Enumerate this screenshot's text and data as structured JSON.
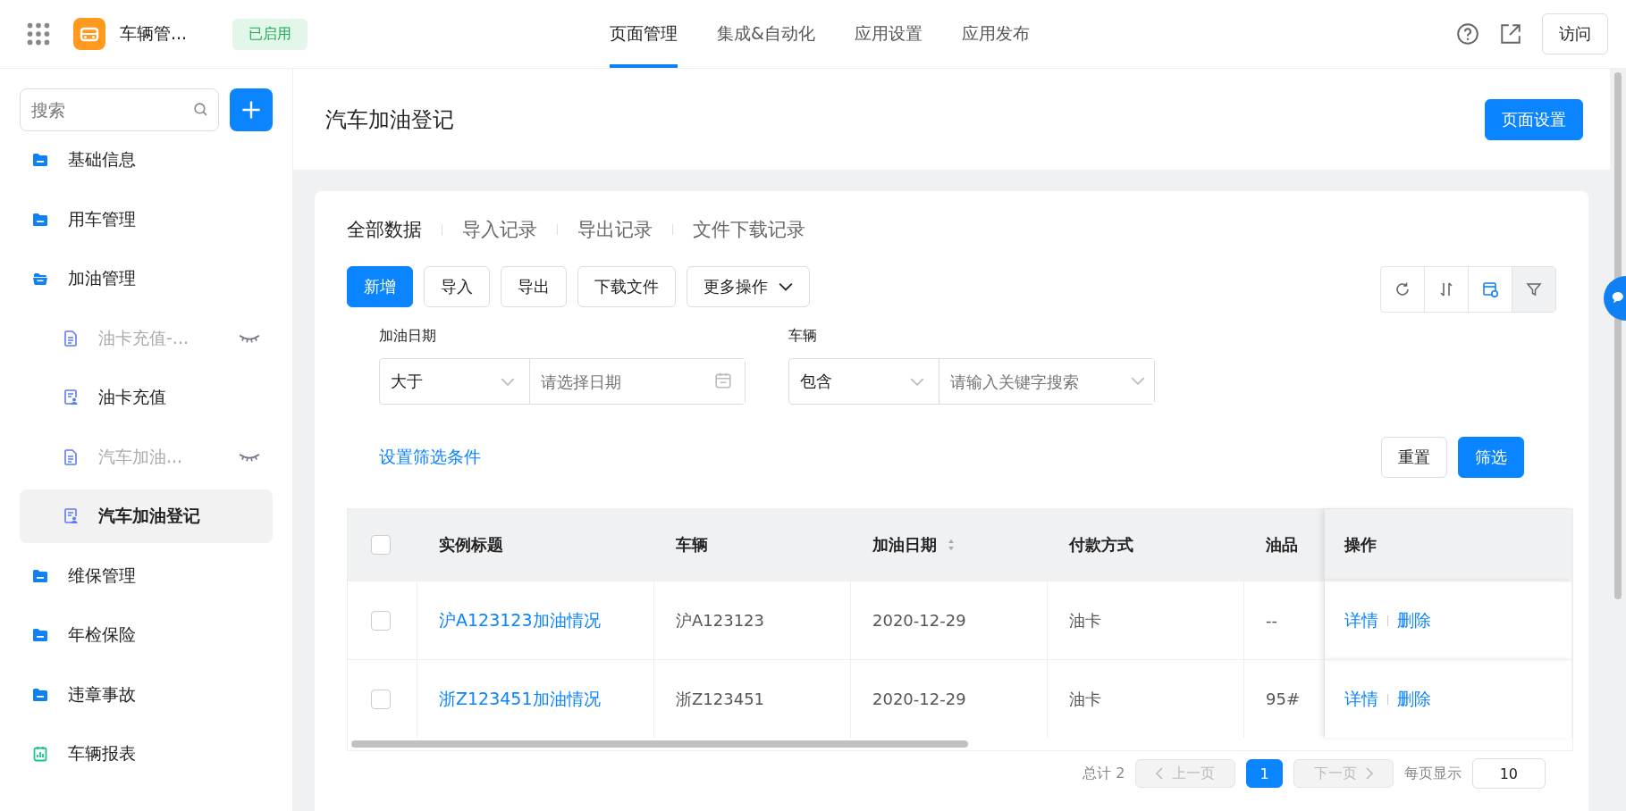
{
  "app": {
    "name": "车辆管...",
    "status": "已启用"
  },
  "nav_tabs": [
    {
      "label": "页面管理",
      "selected": true
    },
    {
      "label": "集成&自动化",
      "selected": false
    },
    {
      "label": "应用设置",
      "selected": false
    },
    {
      "label": "应用发布",
      "selected": false
    }
  ],
  "visit_button": "访问",
  "sidebar": {
    "search": {
      "placeholder": "搜索"
    },
    "items": [
      {
        "label": "基础信息",
        "kind": "folder",
        "expanded": false
      },
      {
        "label": "用车管理",
        "kind": "folder",
        "expanded": false
      },
      {
        "label": "加油管理",
        "kind": "folder",
        "expanded": true,
        "children": [
          {
            "label": "油卡充值-...",
            "kind": "page",
            "hidden": true,
            "selected": false
          },
          {
            "label": "油卡充值",
            "kind": "form",
            "hidden": false,
            "selected": false
          },
          {
            "label": "汽车加油...",
            "kind": "page",
            "hidden": true,
            "selected": false
          },
          {
            "label": "汽车加油登记",
            "kind": "form",
            "hidden": false,
            "selected": true
          }
        ]
      },
      {
        "label": "维保管理",
        "kind": "folder",
        "expanded": false
      },
      {
        "label": "年检保险",
        "kind": "folder",
        "expanded": false
      },
      {
        "label": "违章事故",
        "kind": "folder",
        "expanded": false
      },
      {
        "label": "车辆报表",
        "kind": "report"
      }
    ]
  },
  "page": {
    "title": "汽车加油登记",
    "settings_button": "页面设置"
  },
  "data_tabs": [
    {
      "label": "全部数据",
      "selected": true
    },
    {
      "label": "导入记录",
      "selected": false
    },
    {
      "label": "导出记录",
      "selected": false
    },
    {
      "label": "文件下载记录",
      "selected": false
    }
  ],
  "actions": [
    {
      "label": "新增",
      "primary": true,
      "dropdown": false
    },
    {
      "label": "导入",
      "primary": false,
      "dropdown": false
    },
    {
      "label": "导出",
      "primary": false,
      "dropdown": false
    },
    {
      "label": "下载文件",
      "primary": false,
      "dropdown": false
    },
    {
      "label": "更多操作",
      "primary": false,
      "dropdown": true
    }
  ],
  "filters": [
    {
      "label": "加油日期",
      "operator": "大于",
      "placeholder": "请选择日期",
      "kind": "date"
    },
    {
      "label": "车辆",
      "operator": "包含",
      "placeholder": "请输入关键字搜索",
      "kind": "select"
    }
  ],
  "filter_link": "设置筛选条件",
  "reset_button": "重置",
  "filter_button": "筛选",
  "table": {
    "select_all": {
      "checked": false
    },
    "columns": [
      {
        "label": "实例标题",
        "sortable": false
      },
      {
        "label": "车辆",
        "sortable": false
      },
      {
        "label": "加油日期",
        "sortable": true
      },
      {
        "label": "付款方式",
        "sortable": false
      },
      {
        "label": "油品",
        "sortable": false
      },
      {
        "label": "操作",
        "sortable": false
      }
    ],
    "rows": [
      {
        "checked": false,
        "cells": [
          "沪A123123加油情况",
          "沪A123123",
          "2020-12-29",
          "油卡",
          "--"
        ],
        "actions": [
          "详情",
          "删除"
        ]
      },
      {
        "checked": false,
        "cells": [
          "浙Z123451加油情况",
          "浙Z123451",
          "2020-12-29",
          "油卡",
          "95#"
        ],
        "actions": [
          "详情",
          "删除"
        ]
      }
    ]
  },
  "pagination": {
    "total": "总计 2",
    "prev": "上一页",
    "pages": [
      {
        "label": "1",
        "selected": true
      }
    ],
    "next": "下一页",
    "page_size_label": "每页显示",
    "page_size": "10"
  }
}
